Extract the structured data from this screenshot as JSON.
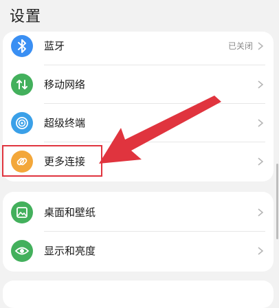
{
  "header": {
    "title": "设置"
  },
  "groups": [
    {
      "items": [
        {
          "label": "蓝牙",
          "value": "已关闭",
          "icon": "bluetooth-icon",
          "color": "#3a8ff3"
        },
        {
          "label": "移动网络",
          "icon": "mobile-data-icon",
          "color": "#43b05c"
        },
        {
          "label": "超级终端",
          "icon": "super-device-icon",
          "color": "#3aa0e8"
        },
        {
          "label": "更多连接",
          "icon": "link-icon",
          "color": "#f3a73a"
        }
      ]
    },
    {
      "items": [
        {
          "label": "桌面和壁纸",
          "icon": "wallpaper-icon",
          "color": "#43b05c"
        },
        {
          "label": "显示和亮度",
          "icon": "eye-icon",
          "color": "#43b05c"
        }
      ]
    }
  ],
  "annotation": {
    "highlight_color": "#e0343e"
  }
}
